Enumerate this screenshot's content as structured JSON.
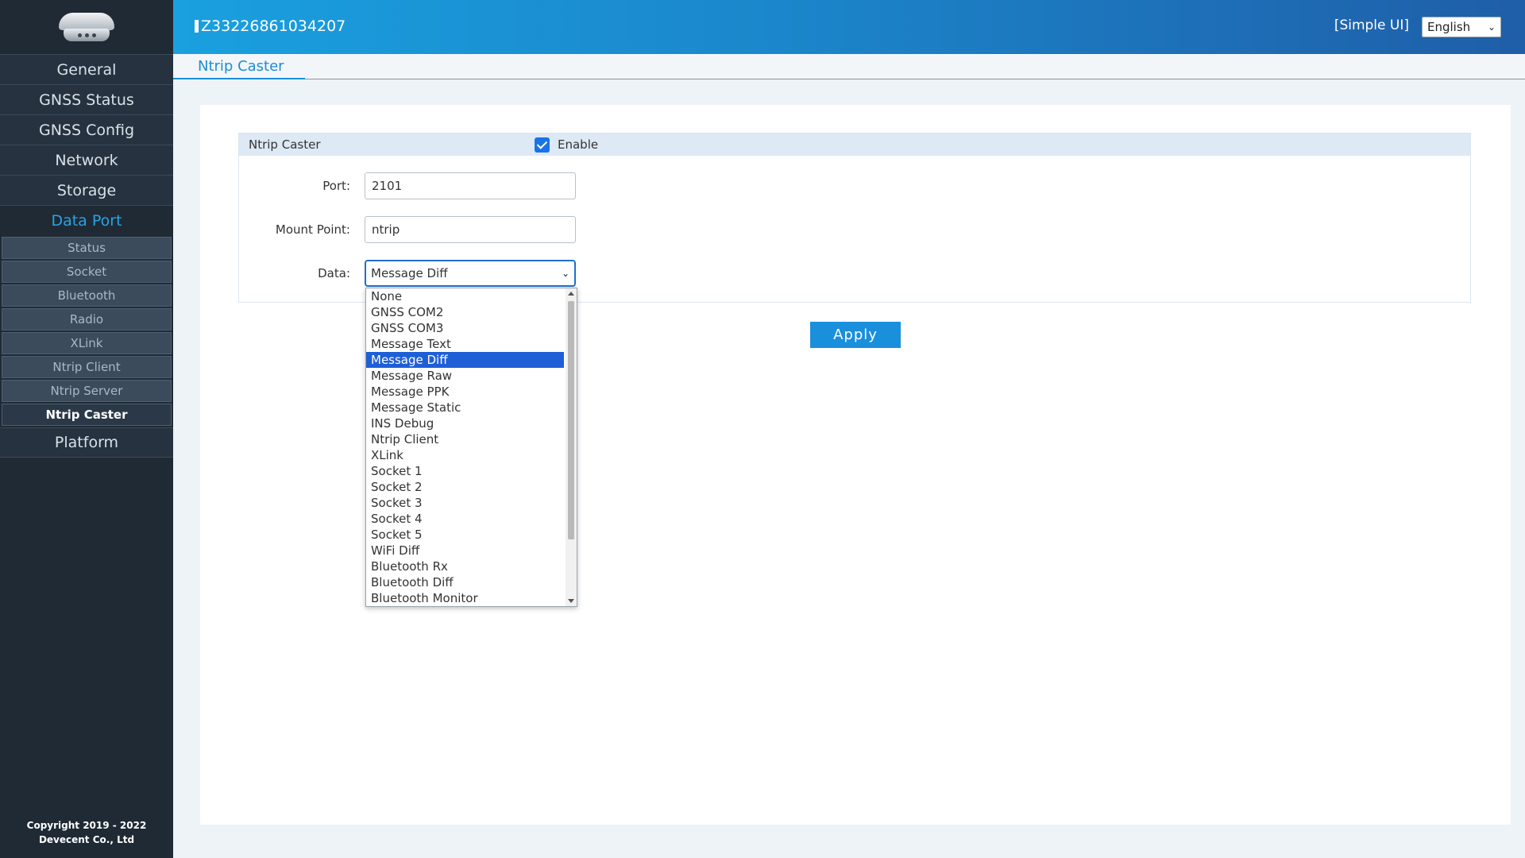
{
  "sidebar": {
    "logo_icon": "gnss-receiver-icon",
    "items": [
      {
        "label": "General"
      },
      {
        "label": "GNSS Status"
      },
      {
        "label": "GNSS Config"
      },
      {
        "label": "Network"
      },
      {
        "label": "Storage"
      },
      {
        "label": "Data Port"
      }
    ],
    "sub_items": [
      {
        "label": "Status"
      },
      {
        "label": "Socket"
      },
      {
        "label": "Bluetooth"
      },
      {
        "label": "Radio"
      },
      {
        "label": "XLink"
      },
      {
        "label": "Ntrip Client"
      },
      {
        "label": "Ntrip Server"
      },
      {
        "label": "Ntrip Caster"
      }
    ],
    "after_items": [
      {
        "label": "Platform"
      }
    ],
    "copyright_line1": "Copyright 2019 - 2022",
    "copyright_line2": "Devecent Co., Ltd"
  },
  "header": {
    "serial": "Z33226861034207",
    "simple_ui": "[Simple UI]",
    "language": "English"
  },
  "tab": {
    "label": "Ntrip Caster"
  },
  "form": {
    "section_title": "Ntrip Caster",
    "enable_label": "Enable",
    "enable_checked": true,
    "port_label": "Port:",
    "port_value": "2101",
    "mount_label": "Mount Point:",
    "mount_value": "ntrip",
    "data_label": "Data:",
    "data_value": "Message Diff",
    "apply_label": "Apply"
  },
  "dropdown": {
    "options": [
      "None",
      "GNSS COM2",
      "GNSS COM3",
      "Message Text",
      "Message Diff",
      "Message Raw",
      "Message PPK",
      "Message Static",
      "INS Debug",
      "Ntrip Client",
      "XLink",
      "Socket 1",
      "Socket 2",
      "Socket 3",
      "Socket 4",
      "Socket 5",
      "WiFi Diff",
      "Bluetooth Rx",
      "Bluetooth Diff",
      "Bluetooth Monitor"
    ],
    "selected": "Message Diff"
  },
  "colors": {
    "accent": "#1a8fdc",
    "sidebar_bg": "#1f2a35",
    "active_nav": "#29a3e6",
    "selected_option": "#1e5fd8"
  }
}
